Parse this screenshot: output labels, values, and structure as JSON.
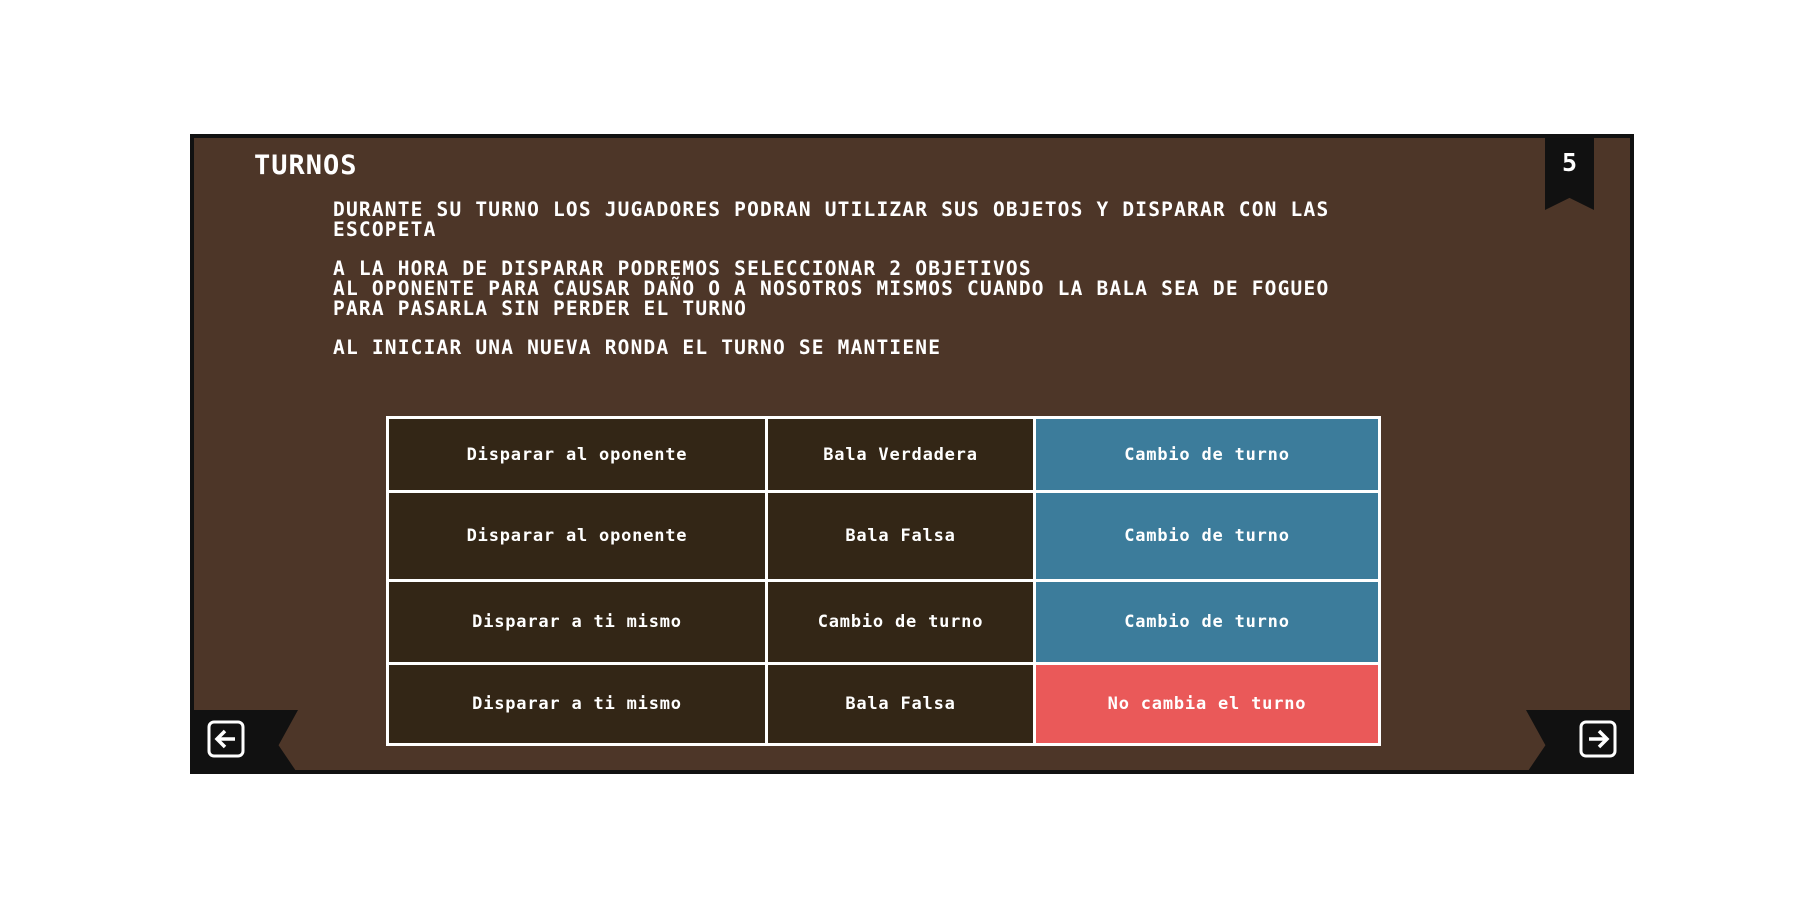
{
  "header": {
    "title": "TURNOS",
    "page_number": "5"
  },
  "body": {
    "paragraphs": [
      [
        "DURANTE SU TURNO LOS JUGADORES PODRAN UTILIZAR SUS OBJETOS Y DISPARAR CON LAS",
        "ESCOPETA"
      ],
      [
        "A LA HORA DE DISPARAR PODREMOS SELECCIONAR 2 OBJETIVOS",
        "AL OPONENTE PARA CAUSAR DAÑO O A NOSOTROS MISMOS CUANDO LA BALA SEA DE FOGUEO",
        "PARA PASARLA SIN PERDER EL TURNO"
      ],
      [
        "AL INICIAR UNA NUEVA RONDA EL TURNO SE MANTIENE"
      ]
    ]
  },
  "table": {
    "rows": [
      [
        "Disparar al oponente",
        "Bala Verdadera",
        "Cambio de turno"
      ],
      [
        "Disparar al oponente",
        "Bala Falsa",
        "Cambio de turno"
      ],
      [
        "Disparar a ti mismo",
        "Cambio de turno",
        "Cambio de turno"
      ],
      [
        "Disparar a ti mismo",
        "Bala Falsa",
        "No cambia el turno"
      ]
    ],
    "colors": {
      "dark": "#332616",
      "change": "#3c7c9b",
      "keep": "#ea5959"
    }
  },
  "nav": {
    "prev_icon": "arrow-left-icon",
    "next_icon": "arrow-right-icon"
  },
  "colors": {
    "panel": "#4d3628",
    "border": "#111111",
    "text": "#ffffff"
  }
}
